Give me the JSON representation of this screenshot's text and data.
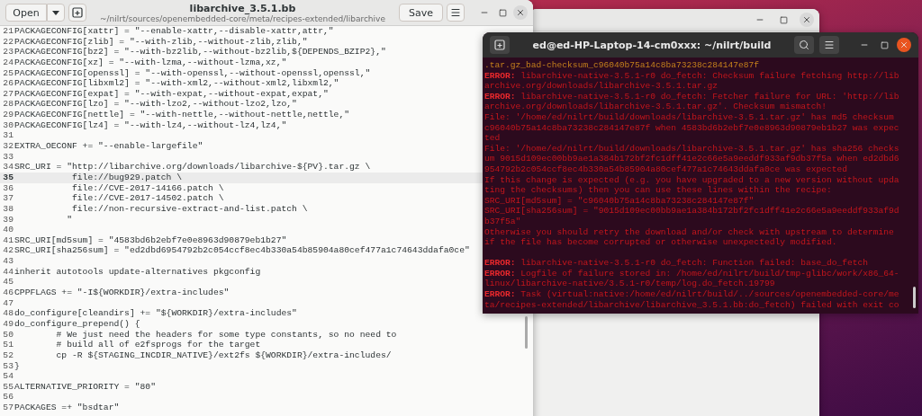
{
  "editor": {
    "title": "libarchive_3.5.1.bb",
    "path": "~/nilrt/sources/openembedded-core/meta/recipes-extended/libarchive",
    "open_label": "Open",
    "save_label": "Save",
    "lines": [
      {
        "number": "21",
        "text": "PACKAGECONFIG[xattr] = \"--enable-xattr,--disable-xattr,attr,\"",
        "current": false
      },
      {
        "number": "22",
        "text": "PACKAGECONFIG[zlib] = \"--with-zlib,--without-zlib,zlib,\"",
        "current": false
      },
      {
        "number": "23",
        "text": "PACKAGECONFIG[bz2] = \"--with-bz2lib,--without-bz2lib,${DEPENDS_BZIP2},\"",
        "current": false
      },
      {
        "number": "24",
        "text": "PACKAGECONFIG[xz] = \"--with-lzma,--without-lzma,xz,\"",
        "current": false
      },
      {
        "number": "25",
        "text": "PACKAGECONFIG[openssl] = \"--with-openssl,--without-openssl,openssl,\"",
        "current": false
      },
      {
        "number": "26",
        "text": "PACKAGECONFIG[libxml2] = \"--with-xml2,--without-xml2,libxml2,\"",
        "current": false
      },
      {
        "number": "27",
        "text": "PACKAGECONFIG[expat] = \"--with-expat,--without-expat,expat,\"",
        "current": false
      },
      {
        "number": "28",
        "text": "PACKAGECONFIG[lzo] = \"--with-lzo2,--without-lzo2,lzo,\"",
        "current": false
      },
      {
        "number": "29",
        "text": "PACKAGECONFIG[nettle] = \"--with-nettle,--without-nettle,nettle,\"",
        "current": false
      },
      {
        "number": "30",
        "text": "PACKAGECONFIG[lz4] = \"--with-lz4,--without-lz4,lz4,\"",
        "current": false
      },
      {
        "number": "31",
        "current": false
      },
      {
        "number": "32",
        "text": "EXTRA_OECONF += \"--enable-largefile\"",
        "current": false
      },
      {
        "number": "33",
        "current": false
      },
      {
        "number": "34",
        "text": "SRC_URI = \"http://libarchive.org/downloads/libarchive-${PV}.tar.gz \\",
        "current": false
      },
      {
        "number": "35",
        "text": "           file://bug929.patch \\",
        "current": true
      },
      {
        "number": "36",
        "text": "           file://CVE-2017-14166.patch \\",
        "current": false
      },
      {
        "number": "37",
        "text": "           file://CVE-2017-14502.patch \\",
        "current": false
      },
      {
        "number": "38",
        "text": "           file://non-recursive-extract-and-list.patch \\",
        "current": false
      },
      {
        "number": "39",
        "text": "          \"",
        "current": false
      },
      {
        "number": "40",
        "current": false
      },
      {
        "number": "41",
        "text": "SRC_URI[md5sum] = \"4583bd6b2ebf7e0e8963d90879eb1b27\"",
        "current": false
      },
      {
        "number": "42",
        "text": "SRC_URI[sha256sum] = \"ed2dbd6954792b2c054ccf8ec4b330a54b85904a80cef477a1c74643ddafa0ce\"",
        "current": false
      },
      {
        "number": "43",
        "current": false
      },
      {
        "number": "44",
        "text": "inherit autotools update-alternatives pkgconfig",
        "current": false
      },
      {
        "number": "45",
        "current": false
      },
      {
        "number": "46",
        "text": "CPPFLAGS += \"-I${WORKDIR}/extra-includes\"",
        "current": false
      },
      {
        "number": "47",
        "current": false
      },
      {
        "number": "48",
        "text": "do_configure[cleandirs] += \"${WORKDIR}/extra-includes\"",
        "current": false
      },
      {
        "number": "49",
        "text": "do_configure_prepend() {",
        "current": false
      },
      {
        "number": "50",
        "text": "        # We just need the headers for some type constants, so no need to",
        "current": false
      },
      {
        "number": "51",
        "text": "        # build all of e2fsprogs for the target",
        "current": false
      },
      {
        "number": "52",
        "text": "        cp -R ${STAGING_INCDIR_NATIVE}/ext2fs ${WORKDIR}/extra-includes/",
        "current": false
      },
      {
        "number": "53",
        "text": "}",
        "current": false
      },
      {
        "number": "54",
        "current": false
      },
      {
        "number": "55",
        "text": "ALTERNATIVE_PRIORITY = \"80\"",
        "current": false
      },
      {
        "number": "56",
        "current": false
      },
      {
        "number": "57",
        "text": "PACKAGES =+ \"bsdtar\"",
        "current": false
      }
    ]
  },
  "terminal": {
    "title": "ed@ed-HP-Laptop-14-cm0xxx: ~/nilrt/build",
    "lines": [
      {
        "kind": "notice",
        "text": ".tar.gz_bad-checksum_c96040b75a14c8ba73238c284147e87f"
      },
      {
        "kind": "error",
        "text": "**ERROR:** libarchive-native-3.5.1-r0 do_fetch: Checksum failure fetching http://lib"
      },
      {
        "kind": "error",
        "text": "archive.org/downloads/libarchive-3.5.1.tar.gz"
      },
      {
        "kind": "error",
        "text": "**ERROR:** libarchive-native-3.5.1-r0 do_fetch: Fetcher failure for URL: 'http://lib"
      },
      {
        "kind": "error",
        "text": "archive.org/downloads/libarchive-3.5.1.tar.gz'. Checksum mismatch!"
      },
      {
        "kind": "error",
        "text": "File: '/home/ed/nilrt/build/downloads/libarchive-3.5.1.tar.gz' has md5 checksum"
      },
      {
        "kind": "error",
        "text": "c96040b75a14c8ba73238c284147e87f when 4583bd6b2ebf7e0e8963d90879eb1b27 was expec"
      },
      {
        "kind": "error",
        "text": "ted"
      },
      {
        "kind": "error",
        "text": "File: '/home/ed/nilrt/build/downloads/libarchive-3.5.1.tar.gz' has sha256 checks"
      },
      {
        "kind": "error",
        "text": "um 9015d109ec00bb9ae1a384b172bf2fc1dff41e2c66e5a9eeddf933af9db37f5a when ed2dbd6"
      },
      {
        "kind": "error",
        "text": "954792b2c054ccf8ec4b330a54b85904a80cef477a1c74643ddafa0ce was expected"
      },
      {
        "kind": "error",
        "text": "If this change is expected (e.g. you have upgraded to a new version without upda"
      },
      {
        "kind": "error",
        "text": "ting the checksums) then you can use these lines within the recipe:"
      },
      {
        "kind": "error",
        "text": "SRC_URI[md5sum] = \"c96040b75a14c8ba73238c284147e87f\""
      },
      {
        "kind": "error",
        "text": "SRC_URI[sha256sum] = \"9015d109ec00bb9ae1a384b172bf2fc1dff41e2c66e5a9eeddf933af9d"
      },
      {
        "kind": "error",
        "text": "b37f5a\""
      },
      {
        "kind": "error",
        "text": "Otherwise you should retry the download and/or check with upstream to determine"
      },
      {
        "kind": "error",
        "text": "if the file has become corrupted or otherwise unexpectedly modified."
      },
      {
        "kind": "blank"
      },
      {
        "kind": "error",
        "text": "**ERROR:** libarchive-native-3.5.1-r0 do_fetch: Function failed: base_do_fetch"
      },
      {
        "kind": "error",
        "text": "**ERROR:** Logfile of failure stored in: /home/ed/nilrt/build/tmp-glibc/work/x86_64-"
      },
      {
        "kind": "error",
        "text": "linux/libarchive-native/3.5.1-r0/temp/log.do_fetch.19799"
      },
      {
        "kind": "error",
        "text": "**ERROR:** Task (virtual:native:/home/ed/nilrt/build/../sources/openembedded-core/me"
      },
      {
        "kind": "error",
        "text": "ta/recipes-extended/libarchive/libarchive_3.5.1.bb:do_fetch) failed with exit co"
      }
    ]
  }
}
